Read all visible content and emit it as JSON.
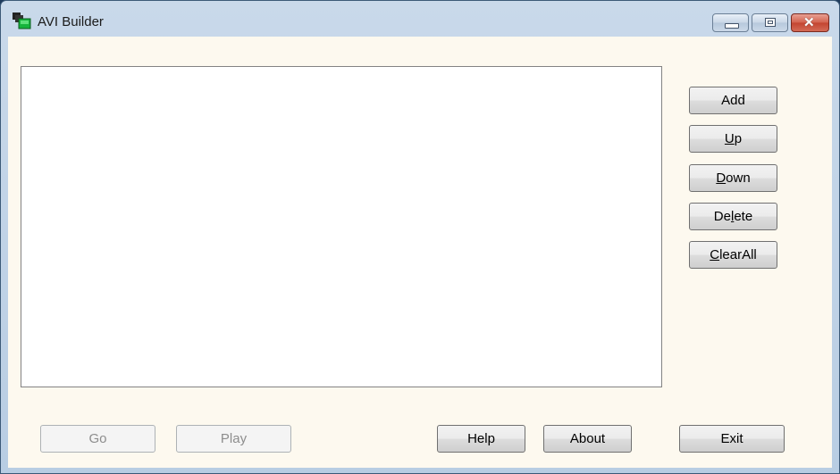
{
  "window": {
    "title": "AVI Builder",
    "icon": "film-clip-icon",
    "controls": {
      "minimize": "minimize-icon",
      "maximize": "maximize-icon",
      "close": "close-icon"
    }
  },
  "file_list": {
    "items": []
  },
  "side_buttons": {
    "add": "Add",
    "up_mnemonic": "U",
    "up_rest": "p",
    "down_mnemonic": "D",
    "down_rest": "own",
    "delete_pre": "De",
    "delete_mnemonic": "l",
    "delete_rest": "ete",
    "clearall_mnemonic": "C",
    "clearall_rest": "learAll"
  },
  "bottom_buttons": {
    "go": "Go",
    "play": "Play",
    "help": "Help",
    "about": "About",
    "exit": "Exit"
  }
}
